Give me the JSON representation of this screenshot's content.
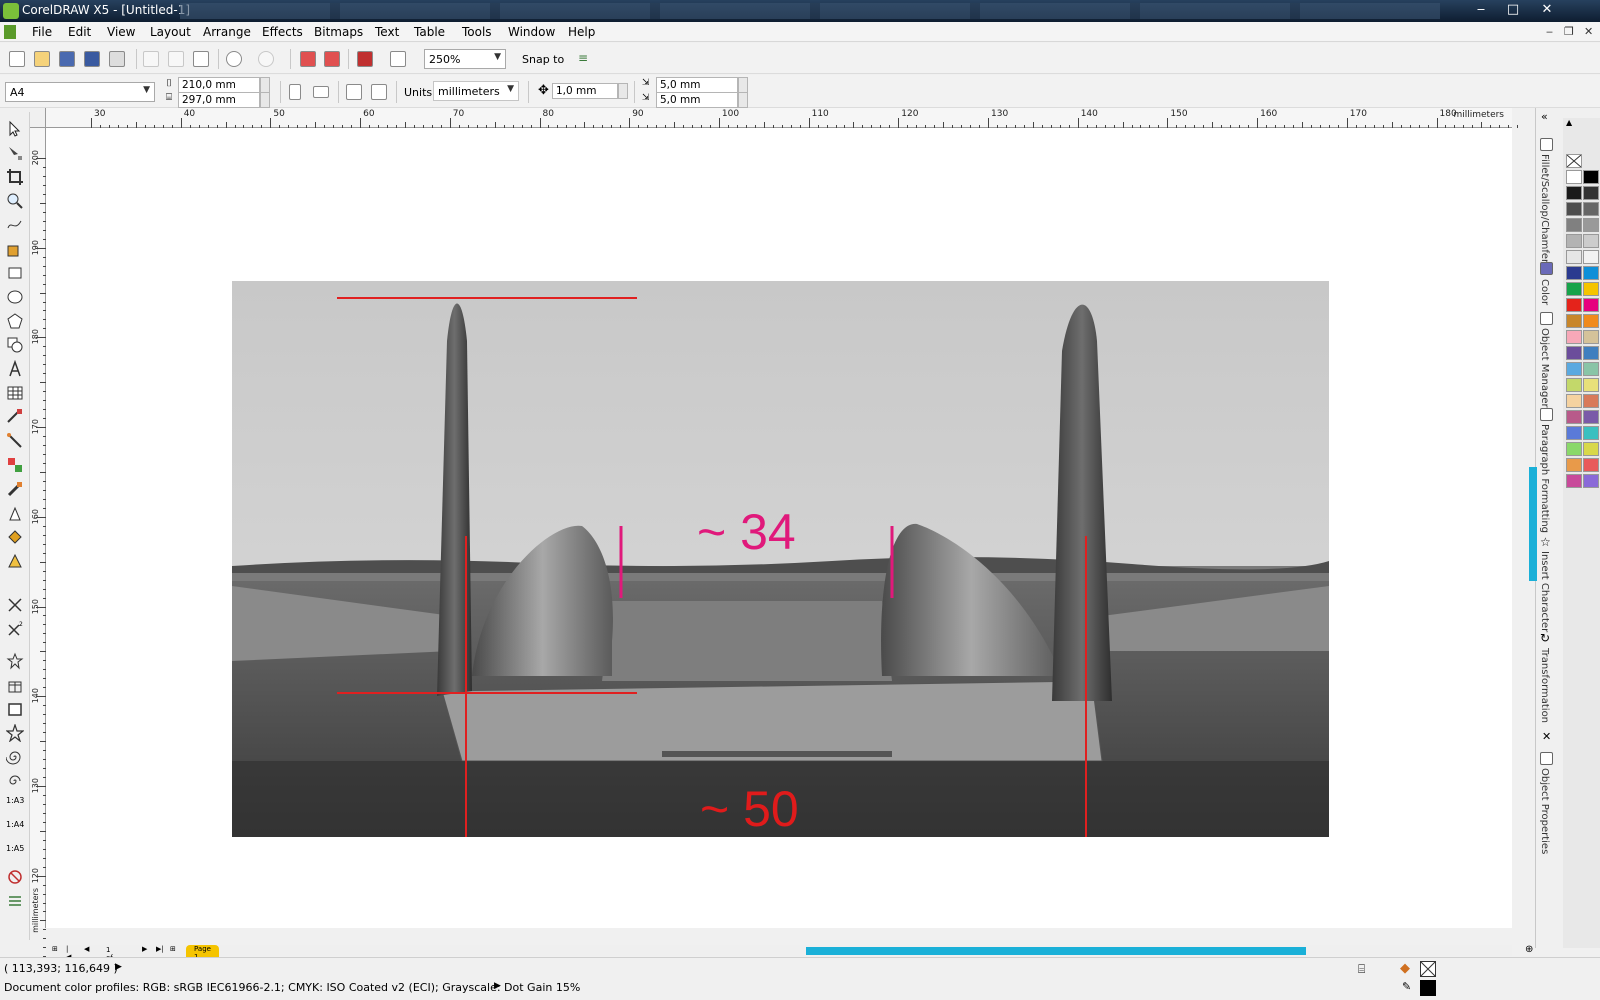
{
  "window": {
    "title": "CorelDRAW X5 - [Untitled-1]",
    "minimize": "‒",
    "maximize": "□",
    "close": "✕"
  },
  "menu": [
    "File",
    "Edit",
    "View",
    "Layout",
    "Arrange",
    "Effects",
    "Bitmaps",
    "Text",
    "Table",
    "Tools",
    "Window",
    "Help"
  ],
  "standard_toolbar": {
    "zoom_level": "250%",
    "snap_to_label": "Snap to"
  },
  "property_bar": {
    "page_size": "A4",
    "page_width": "210,0 mm",
    "page_height": "297,0 mm",
    "units_label": "Units:",
    "units_value": "millimeters",
    "nudge": "1,0 mm",
    "dup_x": "5,0 mm",
    "dup_y": "5,0 mm"
  },
  "ruler": {
    "unit_label": "millimeters",
    "h_ticks": [
      "30",
      "40",
      "50",
      "60",
      "70",
      "80",
      "90",
      "100",
      "110",
      "120",
      "130",
      "140",
      "150",
      "160",
      "170",
      "180"
    ],
    "v_ticks": [
      "200",
      "190",
      "180",
      "170",
      "160",
      "150",
      "140",
      "130",
      "120"
    ],
    "v_unit_label": "millimeters"
  },
  "canvas": {
    "annotation_top": "~ 34",
    "annotation_bottom": "~ 50",
    "annotation_top_color": "#e0197b",
    "annotation_bottom_color": "#e01b1b"
  },
  "dockers": [
    "Fillet/Scallop/Chamfer",
    "Color",
    "Object Manager",
    "Paragraph Formatting",
    "Insert Character",
    "Transformation",
    "Object Properties"
  ],
  "page_nav": {
    "page_count": "1 of 1",
    "page_tab": "Page 1"
  },
  "status": {
    "cursor_coords": "( 113,393; 116,649 )",
    "color_profiles": "Document color profiles: RGB: sRGB IEC61966-2.1; CMYK: ISO Coated v2 (ECI); Grayscale: Dot Gain 15%"
  },
  "palette_colors": [
    "#ffffff",
    "#000000",
    "#1a1a1a",
    "#333333",
    "#4d4d4d",
    "#666666",
    "#808080",
    "#999999",
    "#b3b3b3",
    "#cccccc",
    "#e6e6e6",
    "#f2f2f2",
    "#2b3a8f",
    "#0e8fd8",
    "#17a34a",
    "#f5c400",
    "#e4231b",
    "#e6007e",
    "#c8862a",
    "#f08a1c",
    "#f7a8b8",
    "#d4c29a",
    "#6b4d9b",
    "#3f7fbf",
    "#5aa9e0",
    "#89c4a7",
    "#c3d86a",
    "#e8e07a",
    "#f5d2a0",
    "#d87a5a",
    "#b85a8a",
    "#7a5aa8",
    "#5a7ad8",
    "#3ac0c0",
    "#8ad86a",
    "#d8d84a",
    "#e89a4a",
    "#e85a5a",
    "#c84a9a",
    "#8a6ad8"
  ]
}
